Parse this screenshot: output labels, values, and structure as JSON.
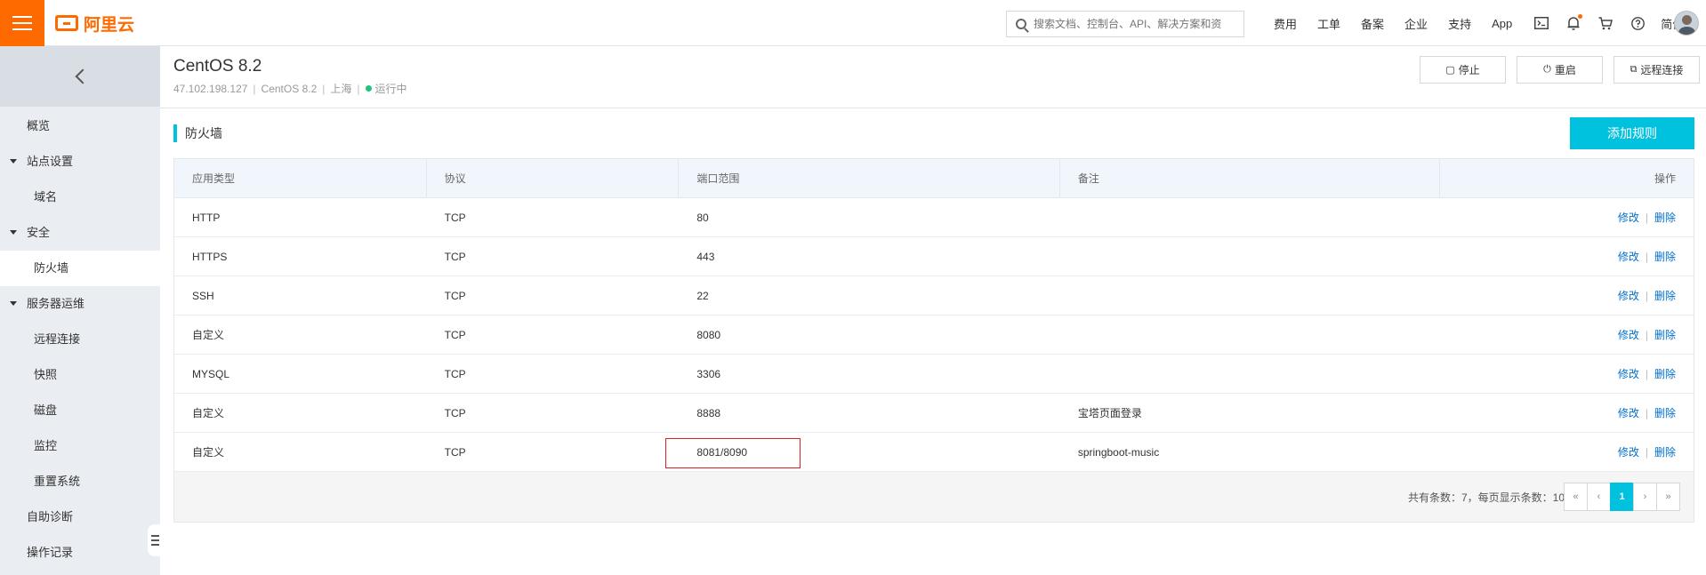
{
  "brand": {
    "name": "阿里云"
  },
  "search": {
    "placeholder": "搜索文档、控制台、API、解决方案和资"
  },
  "nav": {
    "items": [
      "费用",
      "工单",
      "备案",
      "企业",
      "支持",
      "App"
    ],
    "lang": "简体"
  },
  "icons": {
    "terminal": "terminal-icon",
    "bell": "bell-icon",
    "cart": "cart-icon",
    "help": "help-icon"
  },
  "sidebar": {
    "items": [
      {
        "label": "概览"
      },
      {
        "label": "站点设置"
      },
      {
        "label": "域名"
      },
      {
        "label": "安全"
      },
      {
        "label": "防火墙"
      },
      {
        "label": "服务器运维"
      },
      {
        "label": "远程连接"
      },
      {
        "label": "快照"
      },
      {
        "label": "磁盘"
      },
      {
        "label": "监控"
      },
      {
        "label": "重置系统"
      },
      {
        "label": "自助诊断"
      },
      {
        "label": "操作记录"
      }
    ]
  },
  "header": {
    "title": "CentOS 8.2",
    "ip": "47.102.198.127",
    "os": "CentOS 8.2",
    "region": "上海",
    "status": "运行中",
    "sep": "|",
    "stop_label": "停止",
    "restart_label": "重启",
    "remote_label": "远程连接"
  },
  "section": {
    "title": "防火墙",
    "add_label": "添加规则"
  },
  "table": {
    "headers": [
      "应用类型",
      "协议",
      "端口范围",
      "备注",
      "操作"
    ],
    "rows": [
      {
        "type": "HTTP",
        "protocol": "TCP",
        "port": "80",
        "note": ""
      },
      {
        "type": "HTTPS",
        "protocol": "TCP",
        "port": "443",
        "note": ""
      },
      {
        "type": "SSH",
        "protocol": "TCP",
        "port": "22",
        "note": ""
      },
      {
        "type": "自定义",
        "protocol": "TCP",
        "port": "8080",
        "note": ""
      },
      {
        "type": "MYSQL",
        "protocol": "TCP",
        "port": "3306",
        "note": ""
      },
      {
        "type": "自定义",
        "protocol": "TCP",
        "port": "8888",
        "note": "宝塔页面登录"
      },
      {
        "type": "自定义",
        "protocol": "TCP",
        "port": "8081/8090",
        "note": "springboot-music"
      }
    ],
    "edit_label": "修改",
    "delete_label": "删除",
    "action_sep": "|"
  },
  "pagination": {
    "total_text": "共有条数：7，每页显示条数：10",
    "first": "«",
    "prev": "‹",
    "current": "1",
    "next": "›",
    "last": "»"
  },
  "colors": {
    "accent": "#00c1de",
    "brand": "#ff6a00",
    "link": "#0070cc",
    "highlight": "#e02020"
  }
}
